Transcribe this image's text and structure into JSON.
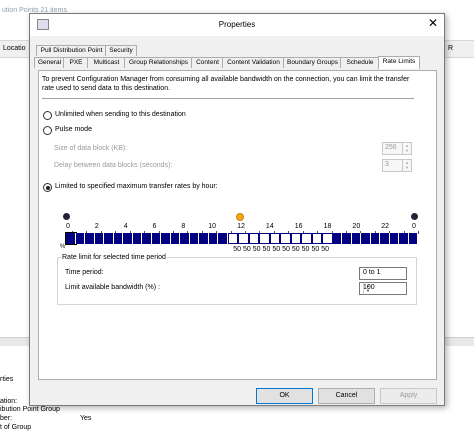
{
  "background": {
    "title": "ution Points 21 items",
    "header_location": "Locatio",
    "header_right": "R",
    "lower_title": "rties",
    "lower_lines": [
      "ation:",
      "ibution Point Group",
      "ber:",
      "t of Group"
    ],
    "yes_value": "Yes"
  },
  "dialog": {
    "title": "Properties",
    "close_glyph": "✕",
    "tabs_row1": [
      "Pull Distribution Point",
      "Security"
    ],
    "tabs_row2": [
      "General",
      "PXE",
      "Multicast",
      "Group Relationships",
      "Content",
      "Content Validation",
      "Boundary Groups",
      "Schedule",
      "Rate Limits"
    ],
    "selected_tab": "Rate Limits",
    "description": "To prevent Configuration Manager from consuming all available bandwidth on the connection, you can  limit the transfer rate used to send data to this destination.",
    "options": {
      "unlimited": "Unlimited when sending to this destination",
      "pulse": "Pulse mode",
      "limited": "Limited to specified maximum transfer rates by hour:"
    },
    "selected_option": "limited",
    "pulse_fields": {
      "block_size_label": "Size of data block (KB):",
      "block_size_value": "256",
      "delay_label": "Delay between data blocks (seconds):",
      "delay_value": "3"
    },
    "schedule": {
      "hour_labels": [
        "0",
        "2",
        "4",
        "6",
        "8",
        "10",
        "12",
        "14",
        "16",
        "18",
        "20",
        "22",
        "0"
      ],
      "percent_symbol": "%",
      "cells": [
        100,
        100,
        100,
        100,
        100,
        100,
        100,
        100,
        100,
        100,
        100,
        100,
        100,
        100,
        100,
        100,
        100,
        50,
        50,
        50,
        50,
        50,
        50,
        50,
        50,
        50,
        50,
        100,
        100,
        100,
        100,
        100,
        100,
        100,
        100,
        100
      ],
      "fifty_label": "50",
      "bar_color": "#000080"
    },
    "rate_group": {
      "title": "Rate limit for selected time period",
      "time_period_label": "Time period:",
      "time_period_value": "0 to 1",
      "bandwidth_label": "Limit available bandwidth (%) :",
      "bandwidth_value": "100"
    },
    "buttons": {
      "ok": "OK",
      "cancel": "Cancel",
      "apply": "Apply"
    },
    "icons": {
      "window": "properties-window-icon",
      "night_left": "moon-icon",
      "noon": "sun-icon",
      "night_right": "moon-icon"
    }
  }
}
